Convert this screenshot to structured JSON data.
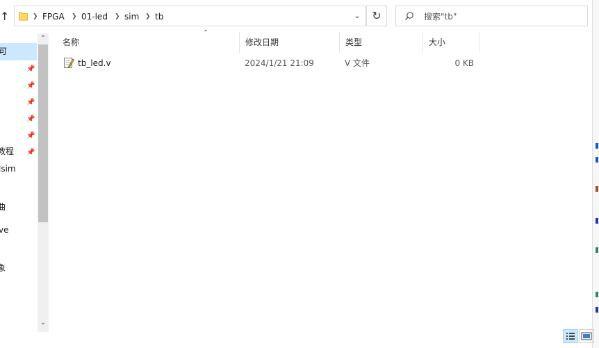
{
  "address_bar": {
    "breadcrumbs": [
      "FPGA",
      "01-led",
      "sim",
      "tb"
    ]
  },
  "search": {
    "placeholder": "搜索\"tb\""
  },
  "nav_pane": {
    "items": [
      {
        "label": "可",
        "pinned": false,
        "selected": true
      },
      {
        "label": "",
        "pinned": true
      },
      {
        "label": "",
        "pinned": true
      },
      {
        "label": "",
        "pinned": true
      },
      {
        "label": "",
        "pinned": true
      },
      {
        "label": "",
        "pinned": true
      },
      {
        "label": "教程",
        "pinned": true
      },
      {
        "label": "lsim",
        "pinned": false
      },
      {
        "label": "曲",
        "pinned": false
      },
      {
        "label": "ve",
        "pinned": false
      },
      {
        "label": "象",
        "pinned": false
      }
    ]
  },
  "columns": [
    {
      "label": "名称"
    },
    {
      "label": "修改日期"
    },
    {
      "label": "类型"
    },
    {
      "label": "大小"
    }
  ],
  "files": [
    {
      "name": "tb_led.v",
      "modified": "2024/1/21 21:09",
      "type": "V 文件",
      "size": "0 KB",
      "icon": "verilog-file-icon"
    }
  ],
  "colors": {
    "selection": "#cce8ff",
    "folder": "#ffd866",
    "accent": "#0b5fc4"
  }
}
